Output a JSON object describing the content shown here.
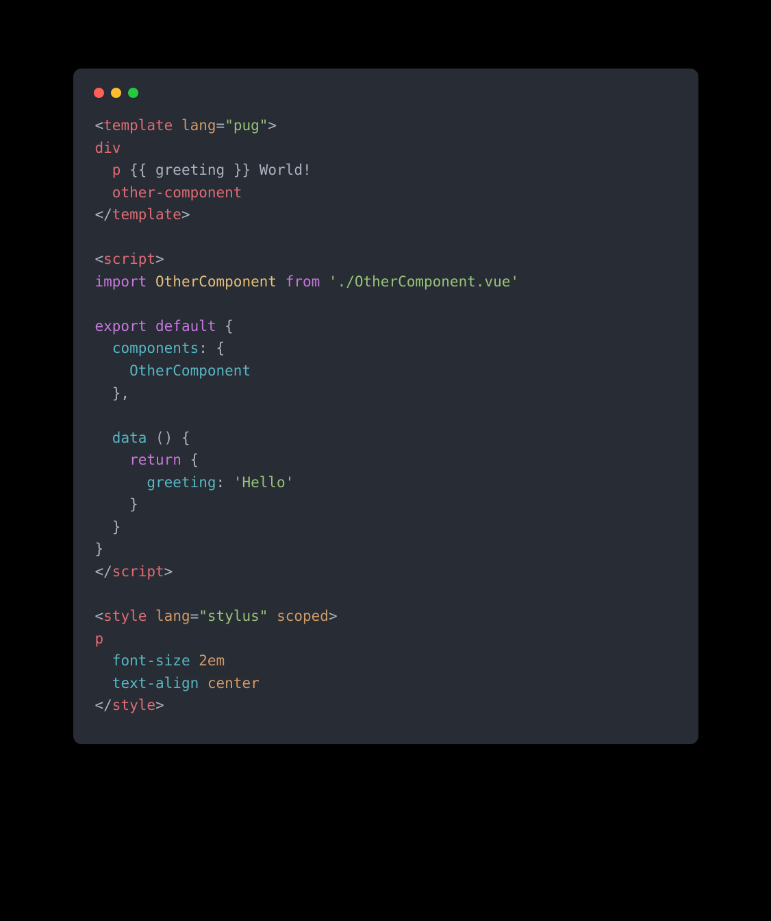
{
  "window": {
    "controls": [
      "close",
      "minimize",
      "zoom"
    ]
  },
  "code": {
    "lines": [
      [
        {
          "t": "<",
          "c": "c-punct"
        },
        {
          "t": "template",
          "c": "c-tag"
        },
        {
          "t": " ",
          "c": "c-plain"
        },
        {
          "t": "lang",
          "c": "c-attr"
        },
        {
          "t": "=",
          "c": "c-punct"
        },
        {
          "t": "\"pug\"",
          "c": "c-str"
        },
        {
          "t": ">",
          "c": "c-punct"
        }
      ],
      [
        {
          "t": "div",
          "c": "c-tag"
        }
      ],
      [
        {
          "t": "  ",
          "c": "c-plain"
        },
        {
          "t": "p",
          "c": "c-tag"
        },
        {
          "t": " {{ greeting }} World!",
          "c": "c-plain"
        }
      ],
      [
        {
          "t": "  ",
          "c": "c-plain"
        },
        {
          "t": "other-component",
          "c": "c-tag"
        }
      ],
      [
        {
          "t": "</",
          "c": "c-punct"
        },
        {
          "t": "template",
          "c": "c-tag"
        },
        {
          "t": ">",
          "c": "c-punct"
        }
      ],
      [
        {
          "t": "",
          "c": "c-plain"
        }
      ],
      [
        {
          "t": "<",
          "c": "c-punct"
        },
        {
          "t": "script",
          "c": "c-tag"
        },
        {
          "t": ">",
          "c": "c-punct"
        }
      ],
      [
        {
          "t": "import",
          "c": "c-kw"
        },
        {
          "t": " ",
          "c": "c-plain"
        },
        {
          "t": "OtherComponent",
          "c": "c-ident"
        },
        {
          "t": " ",
          "c": "c-plain"
        },
        {
          "t": "from",
          "c": "c-kw"
        },
        {
          "t": " ",
          "c": "c-plain"
        },
        {
          "t": "'./OtherComponent.vue'",
          "c": "c-str2"
        }
      ],
      [
        {
          "t": "",
          "c": "c-plain"
        }
      ],
      [
        {
          "t": "export",
          "c": "c-kw"
        },
        {
          "t": " ",
          "c": "c-plain"
        },
        {
          "t": "default",
          "c": "c-kw"
        },
        {
          "t": " {",
          "c": "c-plain"
        }
      ],
      [
        {
          "t": "  ",
          "c": "c-plain"
        },
        {
          "t": "components",
          "c": "c-prop"
        },
        {
          "t": ": {",
          "c": "c-plain"
        }
      ],
      [
        {
          "t": "    ",
          "c": "c-plain"
        },
        {
          "t": "OtherComponent",
          "c": "c-prop"
        }
      ],
      [
        {
          "t": "  },",
          "c": "c-plain"
        }
      ],
      [
        {
          "t": "",
          "c": "c-plain"
        }
      ],
      [
        {
          "t": "  ",
          "c": "c-plain"
        },
        {
          "t": "data",
          "c": "c-fn"
        },
        {
          "t": " () {",
          "c": "c-plain"
        }
      ],
      [
        {
          "t": "    ",
          "c": "c-plain"
        },
        {
          "t": "return",
          "c": "c-kw"
        },
        {
          "t": " {",
          "c": "c-plain"
        }
      ],
      [
        {
          "t": "      ",
          "c": "c-plain"
        },
        {
          "t": "greeting",
          "c": "c-prop"
        },
        {
          "t": ": ",
          "c": "c-plain"
        },
        {
          "t": "'Hello'",
          "c": "c-str2"
        }
      ],
      [
        {
          "t": "    }",
          "c": "c-plain"
        }
      ],
      [
        {
          "t": "  }",
          "c": "c-plain"
        }
      ],
      [
        {
          "t": "}",
          "c": "c-plain"
        }
      ],
      [
        {
          "t": "</",
          "c": "c-punct"
        },
        {
          "t": "script",
          "c": "c-tag"
        },
        {
          "t": ">",
          "c": "c-punct"
        }
      ],
      [
        {
          "t": "",
          "c": "c-plain"
        }
      ],
      [
        {
          "t": "<",
          "c": "c-punct"
        },
        {
          "t": "style",
          "c": "c-tag"
        },
        {
          "t": " ",
          "c": "c-plain"
        },
        {
          "t": "lang",
          "c": "c-attr"
        },
        {
          "t": "=",
          "c": "c-punct"
        },
        {
          "t": "\"stylus\"",
          "c": "c-str"
        },
        {
          "t": " ",
          "c": "c-plain"
        },
        {
          "t": "scoped",
          "c": "c-attr"
        },
        {
          "t": ">",
          "c": "c-punct"
        }
      ],
      [
        {
          "t": "p",
          "c": "c-sel"
        }
      ],
      [
        {
          "t": "  ",
          "c": "c-plain"
        },
        {
          "t": "font-size",
          "c": "c-prop"
        },
        {
          "t": " ",
          "c": "c-plain"
        },
        {
          "t": "2em",
          "c": "c-val"
        }
      ],
      [
        {
          "t": "  ",
          "c": "c-plain"
        },
        {
          "t": "text-align",
          "c": "c-prop"
        },
        {
          "t": " ",
          "c": "c-plain"
        },
        {
          "t": "center",
          "c": "c-val"
        }
      ],
      [
        {
          "t": "</",
          "c": "c-punct"
        },
        {
          "t": "style",
          "c": "c-tag"
        },
        {
          "t": ">",
          "c": "c-punct"
        }
      ]
    ]
  }
}
